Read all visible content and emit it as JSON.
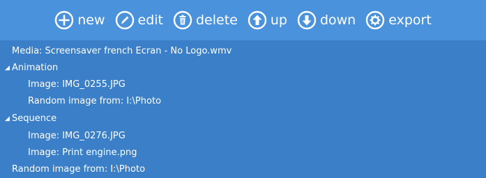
{
  "toolbar": {
    "new_label": "new",
    "edit_label": "edit",
    "delete_label": "delete",
    "up_label": "up",
    "down_label": "down",
    "export_label": "export"
  },
  "icons": {
    "new": "plus-circle-icon",
    "edit": "pencil-circle-icon",
    "delete": "trash-circle-icon",
    "up": "arrow-up-circle-icon",
    "down": "arrow-down-circle-icon",
    "export": "gear-circle-icon"
  },
  "colors": {
    "toolbar_bg": "#4a92dc",
    "panel_bg": "#3a7fc8",
    "text": "#ffffff"
  },
  "tree": {
    "items": [
      {
        "label": "Media: Screensaver french Ecran - No Logo.wmv",
        "level": 0,
        "expander": ""
      },
      {
        "label": "Animation",
        "level": 0,
        "expander": "◢"
      },
      {
        "label": "Image: IMG_0255.JPG",
        "level": 1,
        "expander": ""
      },
      {
        "label": "Random image from: I:\\Photo",
        "level": 1,
        "expander": ""
      },
      {
        "label": "Sequence",
        "level": 0,
        "expander": "◢"
      },
      {
        "label": "Image: IMG_0276.JPG",
        "level": 1,
        "expander": ""
      },
      {
        "label": "Image: Print engine.png",
        "level": 1,
        "expander": ""
      },
      {
        "label": "Random image from: I:\\Photo",
        "level": 0,
        "expander": ""
      }
    ]
  }
}
